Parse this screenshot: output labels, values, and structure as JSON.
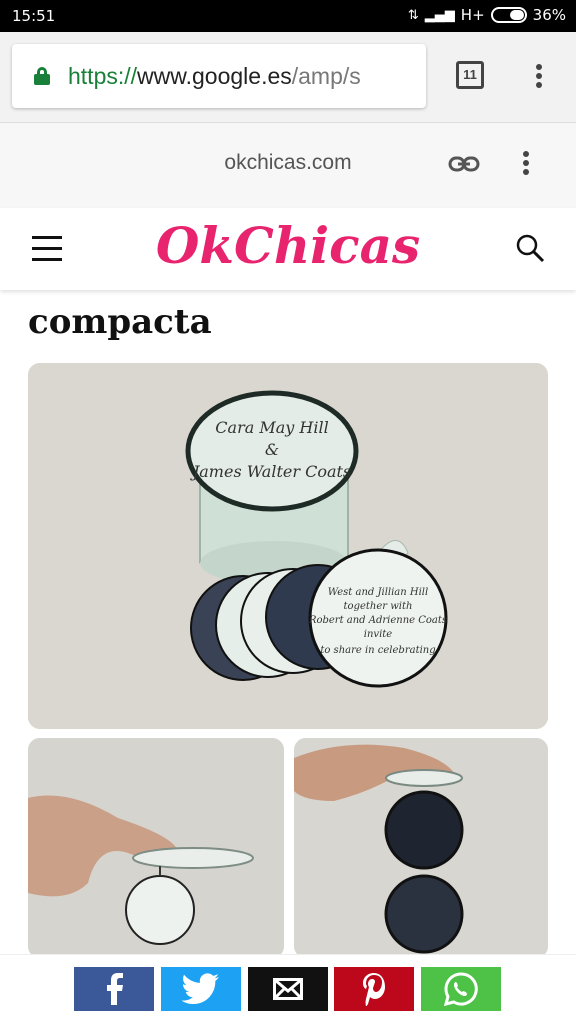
{
  "status_bar": {
    "time": "15:51",
    "network": "H+",
    "battery": "36%"
  },
  "browser": {
    "url_scheme": "https://",
    "url_host": "www.google.es",
    "url_path": "/amp/s",
    "tab_count": "11"
  },
  "amp_header": {
    "domain": "okchicas.com"
  },
  "site": {
    "logo": "OkChicas"
  },
  "article": {
    "title": "compacta"
  },
  "photos": {
    "box_lid_text": "Cara May Hill & James Walter Coats",
    "card_text": "West and Jillian Hill together with Robert and Adrienne Coats invite you to share in celebrating the marriage of"
  },
  "share_bar": {
    "buttons": [
      "facebook",
      "twitter",
      "email",
      "pinterest",
      "whatsapp"
    ]
  },
  "colors": {
    "brand": "#e8246f",
    "secure": "#188038",
    "facebook": "#3b5998",
    "twitter": "#1da1f2",
    "email": "#111111",
    "pinterest": "#bd081c",
    "whatsapp": "#4dc247"
  }
}
